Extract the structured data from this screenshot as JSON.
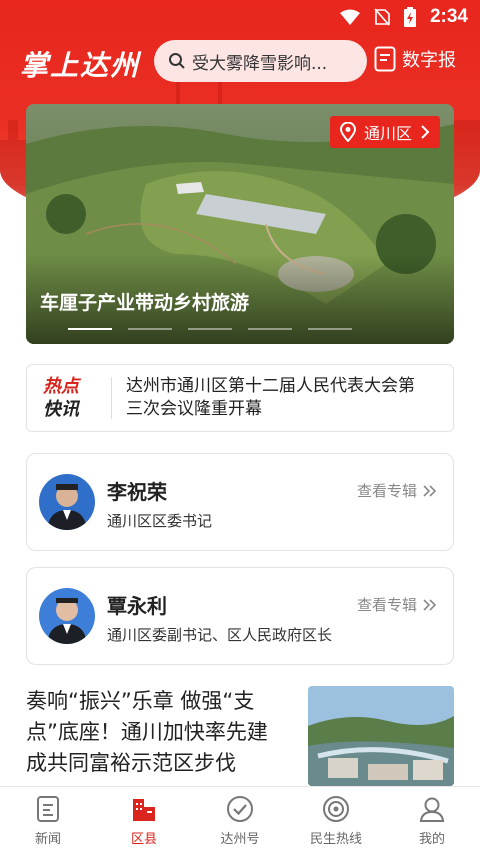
{
  "status_bar": {
    "time": "2:34"
  },
  "header": {
    "logo": "掌上达州",
    "search_placeholder": "受大雾降雪影响...",
    "digital_paper_label": "数字报"
  },
  "banner": {
    "district": "通川区",
    "caption": "车厘子产业带动乡村旅游",
    "slide_count": 5,
    "active_slide": 1
  },
  "hot_news": {
    "logo_line1": "热点",
    "logo_line2": "快讯",
    "text": "达州市通川区第十二届人民代表大会第三次会议隆重开幕"
  },
  "leaders": [
    {
      "name": "李祝荣",
      "title": "通川区区委书记",
      "link": "查看专辑"
    },
    {
      "name": "覃永利",
      "title": "通川区委副书记、区人民政府区长",
      "link": "查看专辑"
    }
  ],
  "news": {
    "title": "奏响“振兴”乐章 做强“支点”底座！通川加快率先建成共同富裕示范区步伐"
  },
  "tabs": [
    {
      "label": "新闻",
      "icon": "news-icon",
      "active": false
    },
    {
      "label": "区县",
      "icon": "district-icon",
      "active": true
    },
    {
      "label": "达州号",
      "icon": "dazhou-account-icon",
      "active": false
    },
    {
      "label": "民生热线",
      "icon": "hotline-icon",
      "active": false
    },
    {
      "label": "我的",
      "icon": "profile-icon",
      "active": false
    }
  ],
  "colors": {
    "brand_red": "#e8261d",
    "accent_red": "#d9251d",
    "tab_inactive": "#666666"
  }
}
